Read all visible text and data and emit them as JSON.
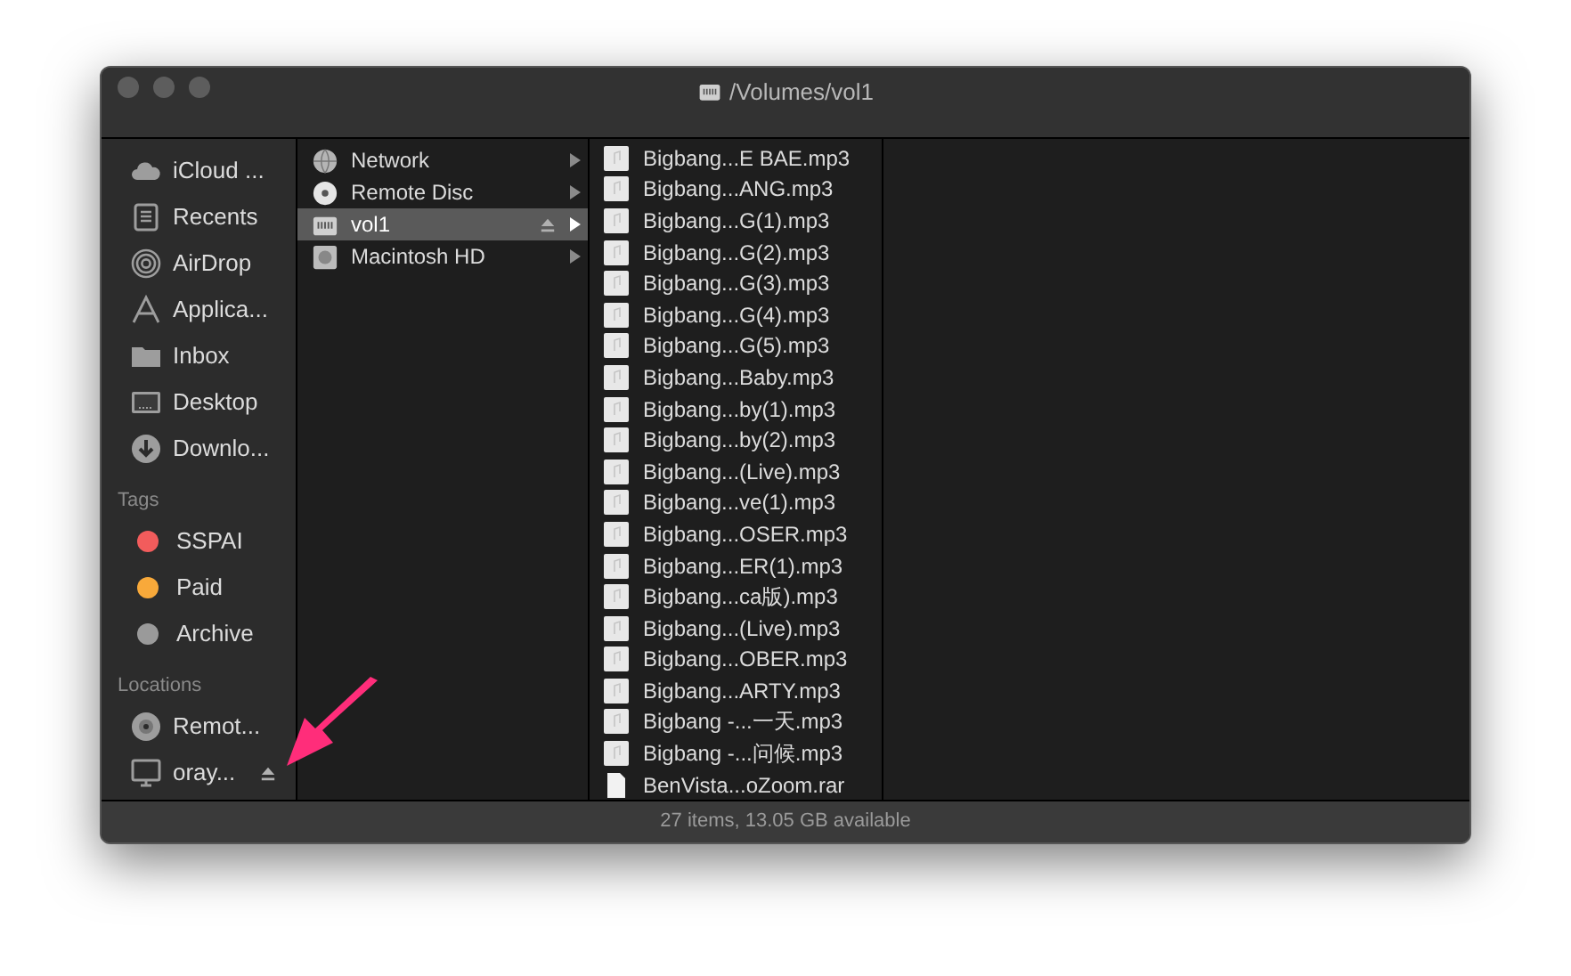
{
  "window": {
    "title": "/Volumes/vol1"
  },
  "sidebar": {
    "favorites": [
      {
        "label": "iCloud ...",
        "kind": "cloud"
      },
      {
        "label": "Recents",
        "kind": "recents"
      },
      {
        "label": "AirDrop",
        "kind": "airdrop"
      },
      {
        "label": "Applica...",
        "kind": "apps"
      },
      {
        "label": "Inbox",
        "kind": "folder"
      },
      {
        "label": "Desktop",
        "kind": "desktop"
      },
      {
        "label": "Downlo...",
        "kind": "download"
      }
    ],
    "tags_heading": "Tags",
    "tags": [
      {
        "label": "SSPAI",
        "color": "#f25c5c"
      },
      {
        "label": "Paid",
        "color": "#f8a93a"
      },
      {
        "label": "Archive",
        "color": "#9a9a9a"
      }
    ],
    "locations_heading": "Locations",
    "locations": [
      {
        "label": "Remot...",
        "kind": "disc",
        "eject": false
      },
      {
        "label": "oray...",
        "kind": "display",
        "eject": true
      }
    ]
  },
  "volumes": [
    {
      "label": "Network",
      "kind": "network",
      "selected": false,
      "eject": false
    },
    {
      "label": "Remote Disc",
      "kind": "disc",
      "selected": false,
      "eject": false
    },
    {
      "label": "vol1",
      "kind": "drive",
      "selected": true,
      "eject": true
    },
    {
      "label": "Macintosh HD",
      "kind": "hd",
      "selected": false,
      "eject": false
    }
  ],
  "files": [
    {
      "name": "Bigbang...E BAE.mp3",
      "kind": "audio"
    },
    {
      "name": "Bigbang...ANG.mp3",
      "kind": "audio"
    },
    {
      "name": "Bigbang...G(1).mp3",
      "kind": "audio"
    },
    {
      "name": "Bigbang...G(2).mp3",
      "kind": "audio"
    },
    {
      "name": "Bigbang...G(3).mp3",
      "kind": "audio"
    },
    {
      "name": "Bigbang...G(4).mp3",
      "kind": "audio"
    },
    {
      "name": "Bigbang...G(5).mp3",
      "kind": "audio"
    },
    {
      "name": "Bigbang...Baby.mp3",
      "kind": "audio"
    },
    {
      "name": "Bigbang...by(1).mp3",
      "kind": "audio"
    },
    {
      "name": "Bigbang...by(2).mp3",
      "kind": "audio"
    },
    {
      "name": "Bigbang...(Live).mp3",
      "kind": "audio"
    },
    {
      "name": "Bigbang...ve(1).mp3",
      "kind": "audio"
    },
    {
      "name": "Bigbang...OSER.mp3",
      "kind": "audio"
    },
    {
      "name": "Bigbang...ER(1).mp3",
      "kind": "audio"
    },
    {
      "name": "Bigbang...ca版).mp3",
      "kind": "audio"
    },
    {
      "name": "Bigbang...(Live).mp3",
      "kind": "audio"
    },
    {
      "name": "Bigbang...OBER.mp3",
      "kind": "audio"
    },
    {
      "name": "Bigbang...ARTY.mp3",
      "kind": "audio"
    },
    {
      "name": "Bigbang -...一天.mp3",
      "kind": "audio"
    },
    {
      "name": "Bigbang -...问候.mp3",
      "kind": "audio"
    },
    {
      "name": "BenVista...oZoom.rar",
      "kind": "document"
    }
  ],
  "status_bar": "27 items, 13.05 GB available"
}
